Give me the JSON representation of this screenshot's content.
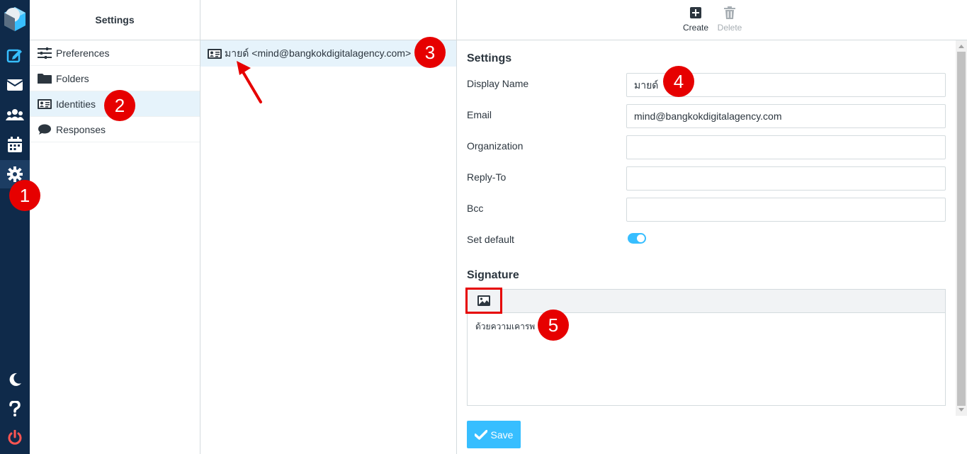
{
  "app": {
    "rail": {
      "items": [
        {
          "icon": "compose-icon"
        },
        {
          "icon": "mail-icon"
        },
        {
          "icon": "contacts-icon"
        },
        {
          "icon": "calendar-icon"
        },
        {
          "icon": "gear-icon",
          "active": true
        },
        {
          "icon": "moon-icon"
        },
        {
          "icon": "help-icon"
        },
        {
          "icon": "power-icon"
        }
      ]
    },
    "settings_menu": {
      "title": "Settings",
      "items": [
        {
          "label": "Preferences",
          "icon": "sliders-icon"
        },
        {
          "label": "Folders",
          "icon": "folder-icon"
        },
        {
          "label": "Identities",
          "icon": "id-card-icon",
          "selected": true
        },
        {
          "label": "Responses",
          "icon": "comment-icon"
        }
      ]
    },
    "identities_list": {
      "items": [
        {
          "label": "มายด์ <mind@bangkokdigitalagency.com>",
          "icon": "id-card-icon"
        }
      ]
    },
    "toolbar": {
      "create_label": "Create",
      "delete_label": "Delete"
    },
    "form": {
      "settings_title": "Settings",
      "display_name_label": "Display Name",
      "display_name_value": "มายด์",
      "email_label": "Email",
      "email_value": "mind@bangkokdigitalagency.com",
      "organization_label": "Organization",
      "organization_value": "",
      "reply_to_label": "Reply-To",
      "reply_to_value": "",
      "bcc_label": "Bcc",
      "bcc_value": "",
      "set_default_label": "Set default",
      "set_default_on": true,
      "signature_title": "Signature",
      "signature_text": "ด้วยความเคารพ",
      "save_label": "Save"
    },
    "annotations": [
      "1",
      "2",
      "3",
      "4",
      "5"
    ],
    "colors": {
      "rail_bg": "#0f2a4a",
      "accent": "#37beff",
      "selected_bg": "#e6f3fb",
      "badge_red": "#e60000",
      "power_red": "#ff5552"
    }
  }
}
